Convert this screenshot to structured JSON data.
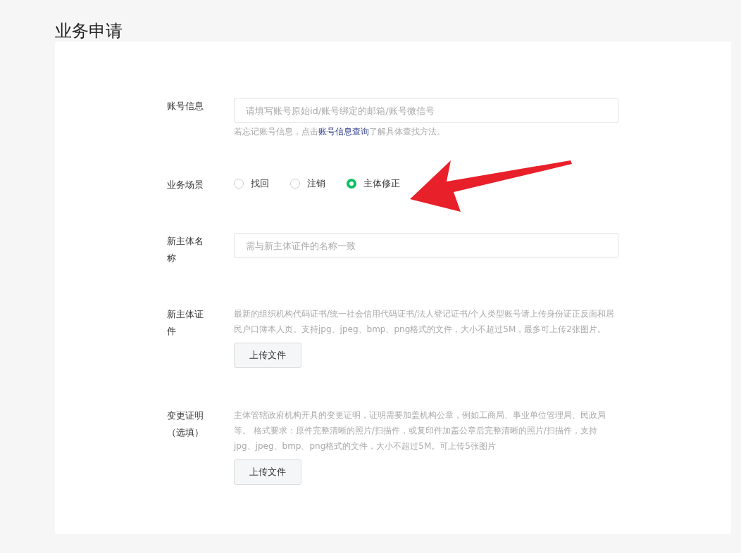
{
  "page": {
    "title": "业务申请"
  },
  "form": [
    {
      "kind": "input",
      "label": "账号信息",
      "placeholder": "请填写账号原始id/账号绑定的邮箱/账号微信号",
      "hint": {
        "before": "若忘记账号信息，点击",
        "link": "账号信息查询",
        "after": "了解具体查找方法。"
      }
    },
    {
      "kind": "radio",
      "label": "业务场景",
      "options": [
        {
          "label": "找回",
          "selected": false
        },
        {
          "label": "注销",
          "selected": false
        },
        {
          "label": "主体修正",
          "selected": true
        }
      ]
    },
    {
      "kind": "input",
      "label": "新主体名称",
      "placeholder": "需与新主体证件的名称一致"
    },
    {
      "kind": "upload",
      "label": "新主体证件",
      "description": "最新的组织机构代码证书/统一社会信用代码证书/法人登记证书/个人类型账号请上传身份证正反面和居民户口簿本人页。支持jpg、jpeg、bmp、png格式的文件，大小不超过5M，最多可上传2张图片。",
      "button": "上传文件"
    },
    {
      "kind": "upload",
      "label": "变更证明（选填）",
      "description": "主体管辖政府机构开具的变更证明，证明需要加盖机构公章，例如工商局、事业单位管理局、民政局等。 格式要求：原件完整清晰的照片/扫描件，或复印件加盖公章后完整清晰的照片/扫描件，支持jpg、jpeg、bmp、png格式的文件，大小不超过5M。可上传5张图片",
      "button": "上传文件"
    }
  ]
}
